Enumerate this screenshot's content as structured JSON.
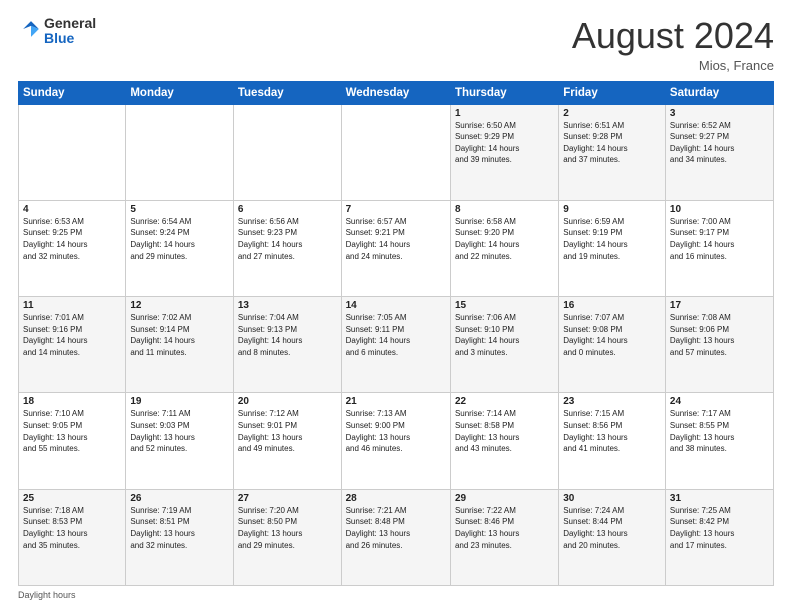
{
  "header": {
    "logo_general": "General",
    "logo_blue": "Blue",
    "month_title": "August 2024",
    "location": "Mios, France"
  },
  "footer": {
    "note": "Daylight hours"
  },
  "days_of_week": [
    "Sunday",
    "Monday",
    "Tuesday",
    "Wednesday",
    "Thursday",
    "Friday",
    "Saturday"
  ],
  "weeks": [
    [
      {
        "num": "",
        "info": ""
      },
      {
        "num": "",
        "info": ""
      },
      {
        "num": "",
        "info": ""
      },
      {
        "num": "",
        "info": ""
      },
      {
        "num": "1",
        "info": "Sunrise: 6:50 AM\nSunset: 9:29 PM\nDaylight: 14 hours\nand 39 minutes."
      },
      {
        "num": "2",
        "info": "Sunrise: 6:51 AM\nSunset: 9:28 PM\nDaylight: 14 hours\nand 37 minutes."
      },
      {
        "num": "3",
        "info": "Sunrise: 6:52 AM\nSunset: 9:27 PM\nDaylight: 14 hours\nand 34 minutes."
      }
    ],
    [
      {
        "num": "4",
        "info": "Sunrise: 6:53 AM\nSunset: 9:25 PM\nDaylight: 14 hours\nand 32 minutes."
      },
      {
        "num": "5",
        "info": "Sunrise: 6:54 AM\nSunset: 9:24 PM\nDaylight: 14 hours\nand 29 minutes."
      },
      {
        "num": "6",
        "info": "Sunrise: 6:56 AM\nSunset: 9:23 PM\nDaylight: 14 hours\nand 27 minutes."
      },
      {
        "num": "7",
        "info": "Sunrise: 6:57 AM\nSunset: 9:21 PM\nDaylight: 14 hours\nand 24 minutes."
      },
      {
        "num": "8",
        "info": "Sunrise: 6:58 AM\nSunset: 9:20 PM\nDaylight: 14 hours\nand 22 minutes."
      },
      {
        "num": "9",
        "info": "Sunrise: 6:59 AM\nSunset: 9:19 PM\nDaylight: 14 hours\nand 19 minutes."
      },
      {
        "num": "10",
        "info": "Sunrise: 7:00 AM\nSunset: 9:17 PM\nDaylight: 14 hours\nand 16 minutes."
      }
    ],
    [
      {
        "num": "11",
        "info": "Sunrise: 7:01 AM\nSunset: 9:16 PM\nDaylight: 14 hours\nand 14 minutes."
      },
      {
        "num": "12",
        "info": "Sunrise: 7:02 AM\nSunset: 9:14 PM\nDaylight: 14 hours\nand 11 minutes."
      },
      {
        "num": "13",
        "info": "Sunrise: 7:04 AM\nSunset: 9:13 PM\nDaylight: 14 hours\nand 8 minutes."
      },
      {
        "num": "14",
        "info": "Sunrise: 7:05 AM\nSunset: 9:11 PM\nDaylight: 14 hours\nand 6 minutes."
      },
      {
        "num": "15",
        "info": "Sunrise: 7:06 AM\nSunset: 9:10 PM\nDaylight: 14 hours\nand 3 minutes."
      },
      {
        "num": "16",
        "info": "Sunrise: 7:07 AM\nSunset: 9:08 PM\nDaylight: 14 hours\nand 0 minutes."
      },
      {
        "num": "17",
        "info": "Sunrise: 7:08 AM\nSunset: 9:06 PM\nDaylight: 13 hours\nand 57 minutes."
      }
    ],
    [
      {
        "num": "18",
        "info": "Sunrise: 7:10 AM\nSunset: 9:05 PM\nDaylight: 13 hours\nand 55 minutes."
      },
      {
        "num": "19",
        "info": "Sunrise: 7:11 AM\nSunset: 9:03 PM\nDaylight: 13 hours\nand 52 minutes."
      },
      {
        "num": "20",
        "info": "Sunrise: 7:12 AM\nSunset: 9:01 PM\nDaylight: 13 hours\nand 49 minutes."
      },
      {
        "num": "21",
        "info": "Sunrise: 7:13 AM\nSunset: 9:00 PM\nDaylight: 13 hours\nand 46 minutes."
      },
      {
        "num": "22",
        "info": "Sunrise: 7:14 AM\nSunset: 8:58 PM\nDaylight: 13 hours\nand 43 minutes."
      },
      {
        "num": "23",
        "info": "Sunrise: 7:15 AM\nSunset: 8:56 PM\nDaylight: 13 hours\nand 41 minutes."
      },
      {
        "num": "24",
        "info": "Sunrise: 7:17 AM\nSunset: 8:55 PM\nDaylight: 13 hours\nand 38 minutes."
      }
    ],
    [
      {
        "num": "25",
        "info": "Sunrise: 7:18 AM\nSunset: 8:53 PM\nDaylight: 13 hours\nand 35 minutes."
      },
      {
        "num": "26",
        "info": "Sunrise: 7:19 AM\nSunset: 8:51 PM\nDaylight: 13 hours\nand 32 minutes."
      },
      {
        "num": "27",
        "info": "Sunrise: 7:20 AM\nSunset: 8:50 PM\nDaylight: 13 hours\nand 29 minutes."
      },
      {
        "num": "28",
        "info": "Sunrise: 7:21 AM\nSunset: 8:48 PM\nDaylight: 13 hours\nand 26 minutes."
      },
      {
        "num": "29",
        "info": "Sunrise: 7:22 AM\nSunset: 8:46 PM\nDaylight: 13 hours\nand 23 minutes."
      },
      {
        "num": "30",
        "info": "Sunrise: 7:24 AM\nSunset: 8:44 PM\nDaylight: 13 hours\nand 20 minutes."
      },
      {
        "num": "31",
        "info": "Sunrise: 7:25 AM\nSunset: 8:42 PM\nDaylight: 13 hours\nand 17 minutes."
      }
    ]
  ]
}
